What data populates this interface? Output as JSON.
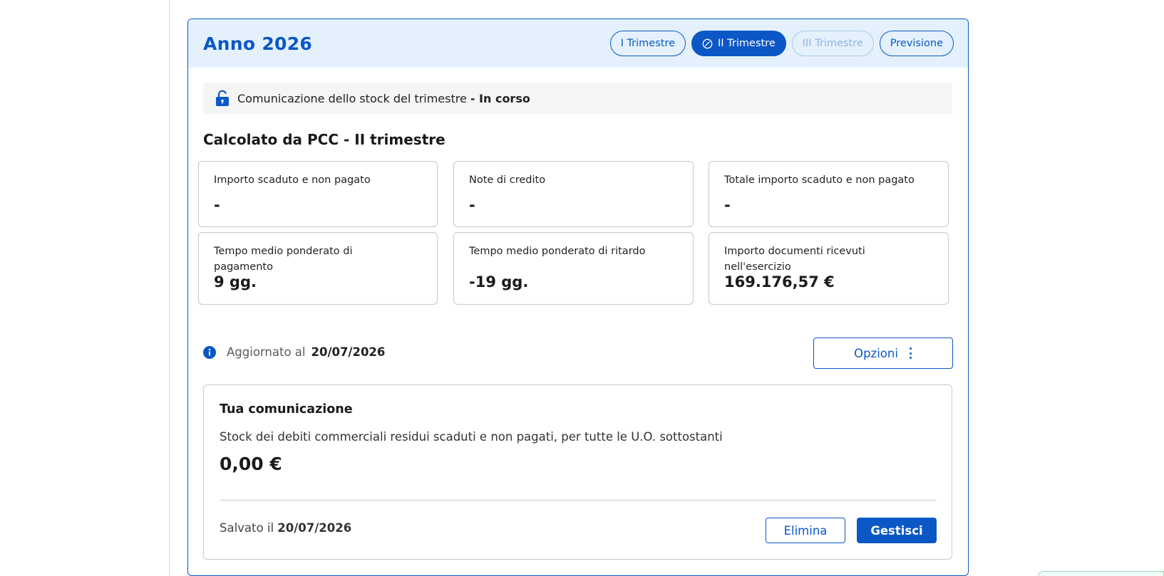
{
  "panel": {
    "year_title": "Anno 2026",
    "tabs": [
      {
        "label": "I Trimestre",
        "state": "default"
      },
      {
        "label": "II Trimestre",
        "state": "active"
      },
      {
        "label": "III Trimestre",
        "state": "disabled"
      },
      {
        "label": "Previsione",
        "state": "default"
      }
    ]
  },
  "status": {
    "icon": "lock-open-icon",
    "text": "Comunicazione dello stock del trimestre",
    "value": "- In corso"
  },
  "calculated": {
    "title": "Calcolato da PCC - II trimestre",
    "cards": [
      {
        "label": "Importo scaduto e non pagato",
        "value": "-"
      },
      {
        "label": "Note di credito",
        "value": "-"
      },
      {
        "label": "Totale importo scaduto e non pagato",
        "value": "-"
      },
      {
        "label": "Tempo medio ponderato di pagamento",
        "value": "9 gg."
      },
      {
        "label": "Tempo medio ponderato di ritardo",
        "value": "-19 gg."
      },
      {
        "label": "Importo documenti ricevuti nell'esercizio",
        "value": "169.176,57 €"
      }
    ]
  },
  "updated": {
    "icon": "info-icon",
    "label": "Aggiornato al",
    "date": "20/07/2026"
  },
  "options_button": {
    "label": "Opzioni",
    "icon": "kebab-icon"
  },
  "communication": {
    "title": "Tua comunicazione",
    "description": "Stock dei debiti commerciali residui scaduti e non pagati, per tutte le U.O. sottostanti",
    "amount": "0,00 €",
    "saved_label": "Salvato il",
    "saved_date": "20/07/2026",
    "delete_label": "Elimina",
    "manage_label": "Gestisci"
  },
  "colors": {
    "primary": "#0b57c6",
    "header_bg": "#e4f1fc",
    "disabled": "#8fb5df"
  }
}
